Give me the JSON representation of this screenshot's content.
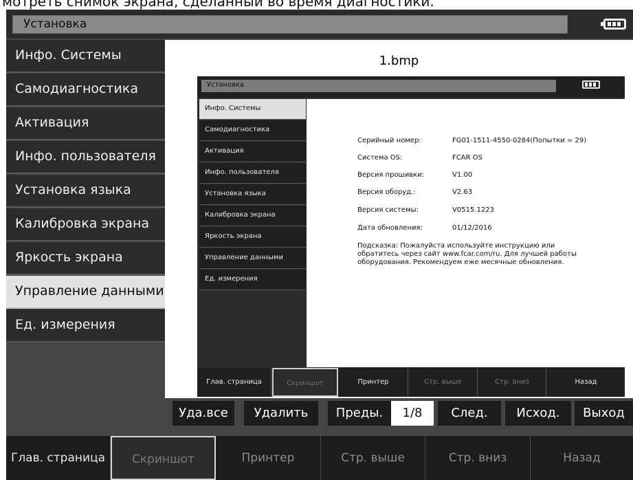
{
  "caption": "мотреть снимок экрана, сделанный во время диагностики.",
  "header": {
    "title": "Установка",
    "battery_icon": "battery-icon"
  },
  "menu": {
    "items": [
      {
        "label": "Инфо. Системы"
      },
      {
        "label": "Самодиагностика"
      },
      {
        "label": "Активация"
      },
      {
        "label": "Инфо. пользователя"
      },
      {
        "label": "Установка языка"
      },
      {
        "label": "Калибровка экрана"
      },
      {
        "label": "Яркость экрана"
      },
      {
        "label": "Управление данными"
      },
      {
        "label": "Ед. измерения"
      }
    ],
    "active": "Управление данными"
  },
  "viewer": {
    "filename": "1.bmp",
    "screenshot": {
      "title": "Установка",
      "menu": [
        {
          "label": "Инфо. Системы"
        },
        {
          "label": "Самодиагностика"
        },
        {
          "label": "Активация"
        },
        {
          "label": "Инфо. пользователя"
        },
        {
          "label": "Установка языка"
        },
        {
          "label": "Калибровка экрана"
        },
        {
          "label": "Яркость экрана"
        },
        {
          "label": "Управление данными"
        },
        {
          "label": "Ед. измерения"
        }
      ],
      "active": "Инфо. Системы",
      "info": [
        {
          "key": "Серийный номер:",
          "value": "FG01-1511-4550-0284(Попытки = 29)"
        },
        {
          "key": "Система OS:",
          "value": "FCAR OS"
        },
        {
          "key": "Версия прошивки:",
          "value": "V1.00"
        },
        {
          "key": "Версия оборуд.:",
          "value": "V2.63"
        },
        {
          "key": "Версия системы:",
          "value": "V0515.1223"
        },
        {
          "key": "Дата обновления:",
          "value": "01/12/2016"
        }
      ],
      "hint": "Подсказка: Пожалуйста используйте инструкцию или обратитесь через сайт www.fcar.com/ru. Для лучшей работы оборудования. Рекомендуем еже месячные обновления.",
      "bottom": [
        {
          "label": "Глав. страница"
        },
        {
          "label": "Скриншот"
        },
        {
          "label": "Принтер"
        },
        {
          "label": "Стр. выше"
        },
        {
          "label": "Стр. вниз"
        },
        {
          "label": "Назад"
        }
      ]
    }
  },
  "nav": {
    "delete_all": "Уда.все",
    "delete": "Удалить",
    "prev": "Преды.",
    "page": "1/8",
    "next": "След.",
    "first": "Исход.",
    "exit": "Выход"
  },
  "bottom": [
    {
      "label": "Глав. страница"
    },
    {
      "label": "Скриншот"
    },
    {
      "label": "Принтер"
    },
    {
      "label": "Стр. выше"
    },
    {
      "label": "Стр. вниз"
    },
    {
      "label": "Назад"
    }
  ]
}
